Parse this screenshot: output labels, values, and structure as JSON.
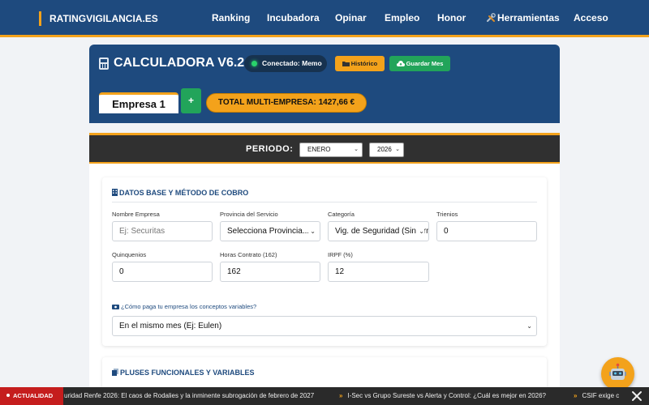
{
  "nav": {
    "brand": "RATINGVIGILANCIA.ES",
    "links": [
      "Ranking",
      "Incubadora",
      "Opinar",
      "Empleo",
      "Honor",
      "Herramientas",
      "Acceso"
    ]
  },
  "calc": {
    "title": "CALCULADORA V6.2",
    "status": "Conectado: Memo",
    "history_button": "Histórico",
    "save_button": "Guardar Mes",
    "company_tab": "Empresa 1",
    "add_button": "+",
    "total_label": "TOTAL MULTI-EMPRESA: 1427,66 €"
  },
  "period": {
    "label": "PERIODO:",
    "month": "ENERO",
    "year": "2026"
  },
  "datos_base": {
    "title": "DATOS BASE Y MÉTODO DE COBRO",
    "fields": {
      "empresa": {
        "label": "Nombre Empresa",
        "placeholder": "Ej: Securitas"
      },
      "provincia": {
        "label": "Provincia del Servicio",
        "value": "Selecciona Provincia..."
      },
      "categoria": {
        "label": "Categoría",
        "value": "Vig. de Seguridad (Sin Arma)"
      },
      "trienios": {
        "label": "Trienios",
        "value": "0"
      },
      "quinquenios": {
        "label": "Quinquenios",
        "value": "0"
      },
      "horas": {
        "label": "Horas Contrato (162)",
        "value": "162"
      },
      "irpf": {
        "label": "IRPF (%)",
        "value": "12"
      }
    },
    "question": "¿Cómo paga tu empresa los conceptos variables?",
    "payment_method": "En el mismo mes (Ej: Eulen)"
  },
  "pluses": {
    "title": "PLUSES FUNCIONALES Y VARIABLES"
  },
  "ticker": {
    "badge": "ACTUALIDAD",
    "items": [
      "uridad Renfe 2026: El caos de Rodalies y la inminente subrogación de febrero de 2027",
      "I-Sec vs Grupo Sureste vs Alerta y Control: ¿Cuál es mejor en 2026?",
      "CSIF exige c"
    ]
  },
  "colors": {
    "navy": "#1e4a7e",
    "accent": "#f3a21b",
    "green": "#22a45a",
    "dark_bar": "#303030",
    "news_red": "#c51d1d"
  }
}
